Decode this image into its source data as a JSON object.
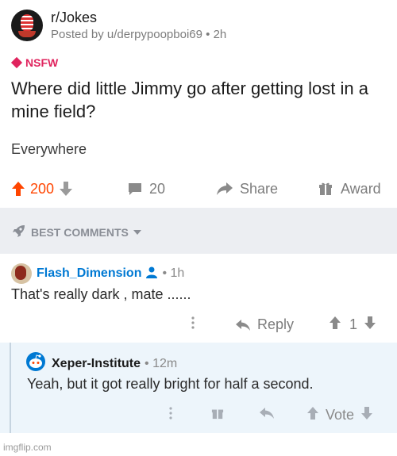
{
  "post": {
    "subreddit": "r/Jokes",
    "posted_by": "Posted by u/derpypoopboi69 • 2h",
    "nsfw_label": "NSFW",
    "title": "Where did little Jimmy go after getting lost in a mine field?",
    "body": "Everywhere",
    "score": "200",
    "comment_count": "20",
    "share_label": "Share",
    "award_label": "Award"
  },
  "sort": {
    "label": "BEST COMMENTS"
  },
  "comments": [
    {
      "username": "Flash_Dimension",
      "meta": "• 1h",
      "text": "That's really dark , mate ......",
      "reply_label": "Reply",
      "score": "1"
    },
    {
      "username": "Xeper-Institute",
      "meta": "• 12m",
      "text": "Yeah, but it got really bright for half a second.",
      "vote_label": "Vote"
    }
  ],
  "watermark": {
    "text": "imgflip.com"
  },
  "colors": {
    "accent_orange": "#ff4500",
    "username_blue": "#0079d3",
    "nsfw_red": "#e0245e",
    "band_gray": "#eceef2",
    "reply_bg": "#edf5fb"
  }
}
